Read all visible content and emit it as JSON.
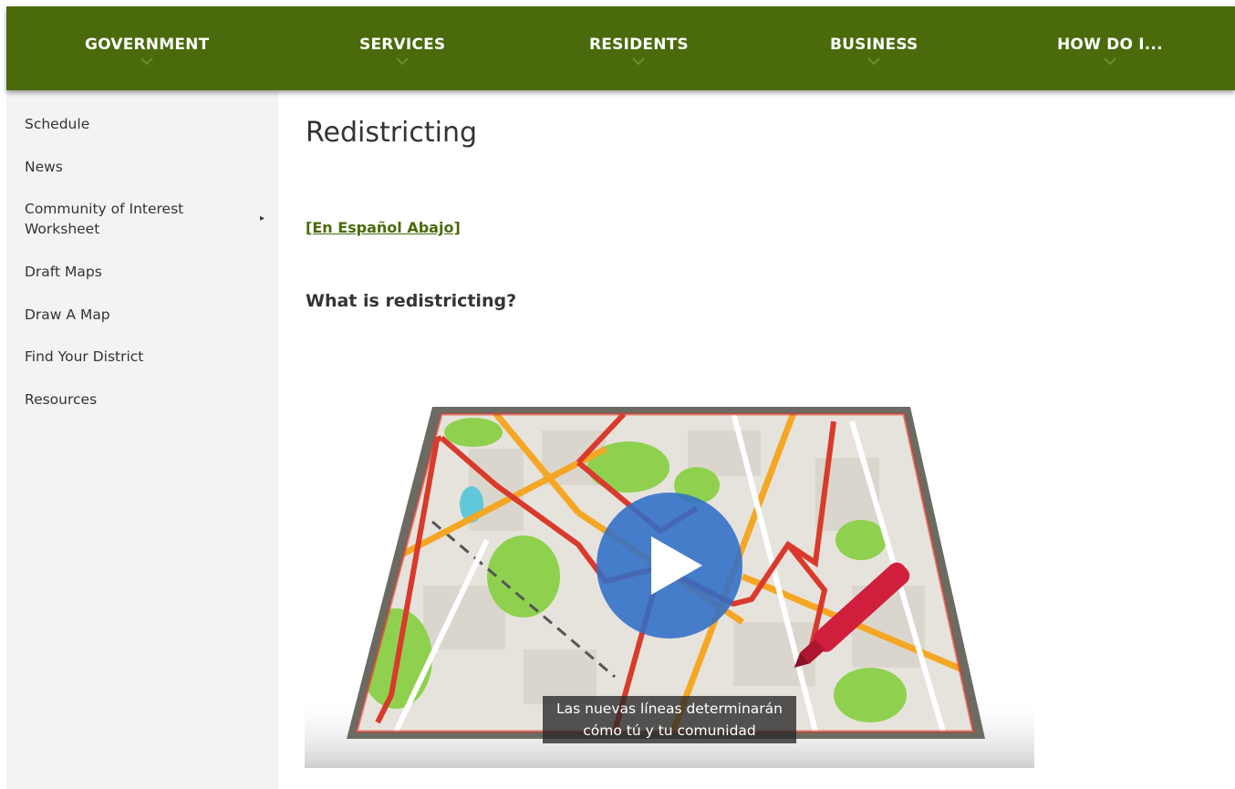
{
  "nav": {
    "items": [
      {
        "label": "GOVERNMENT"
      },
      {
        "label": "SERVICES"
      },
      {
        "label": "RESIDENTS"
      },
      {
        "label": "BUSINESS"
      },
      {
        "label": "HOW DO I..."
      }
    ],
    "background": "#4a6a0b"
  },
  "sidebar": {
    "items": [
      {
        "label": "Schedule"
      },
      {
        "label": "News"
      },
      {
        "label": "Community of Interest Worksheet",
        "has_submenu": true
      },
      {
        "label": "Draft Maps"
      },
      {
        "label": "Draw A Map"
      },
      {
        "label": "Find Your District"
      },
      {
        "label": "Resources"
      }
    ],
    "submenu_arrow": "▸"
  },
  "main": {
    "title": "Redistricting",
    "language_link": "[En Español Abajo]",
    "section_heading": "What is redistricting?",
    "video": {
      "caption_line1": "Las nuevas líneas determinarán",
      "caption_line2": "cómo tú y tu comunidad",
      "play_icon": "play-icon"
    }
  },
  "colors": {
    "accent": "#4a6a0b",
    "link": "#4a6a0b",
    "play_button": "#306ec8"
  }
}
